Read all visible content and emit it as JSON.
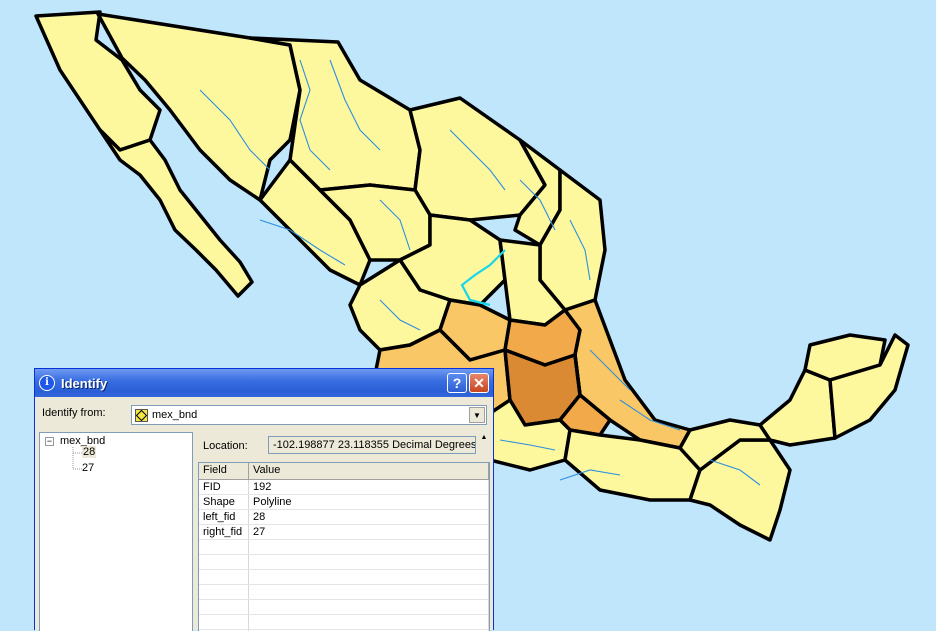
{
  "window": {
    "title": "Identify",
    "help_label": "?",
    "close_label": "✕",
    "info_glyph": "i"
  },
  "identify_from": {
    "label": "Identify from:",
    "value": "mex_bnd",
    "drop_glyph": "▼"
  },
  "tree": {
    "root": "mex_bnd",
    "expander": "−",
    "children": [
      "28",
      "27"
    ]
  },
  "location": {
    "label": "Location:",
    "value": "-102.198877  23.118355 Decimal Degrees"
  },
  "attributes": {
    "headers": [
      "Field",
      "Value"
    ],
    "rows": [
      {
        "field": "FID",
        "value": "192"
      },
      {
        "field": "Shape",
        "value": "Polyline"
      },
      {
        "field": "left_fid",
        "value": "28"
      },
      {
        "field": "right_fid",
        "value": "27"
      }
    ]
  },
  "colors": {
    "ocean": "#bfe6fb",
    "land": "#fdf79d",
    "light_orange": "#f9c766",
    "orange": "#f2a94a",
    "dark_orange": "#d98a32",
    "river": "#2e8fe0",
    "selected_river": "#17d6ea",
    "titlebar": "#2a5ed6"
  }
}
